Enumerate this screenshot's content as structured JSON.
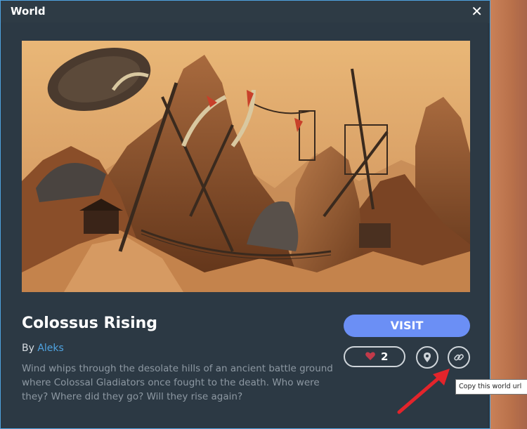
{
  "window": {
    "title": "World",
    "close_glyph": "✕"
  },
  "world": {
    "name": "Colossus Rising",
    "by_prefix": "By ",
    "author": "Aleks",
    "description": "Wind whips through the desolate hills of an ancient battle ground where Colossal Gladiators once fought to the death. Who were they? Where did they go? Will they rise again?"
  },
  "actions": {
    "visit_label": "VISIT",
    "like_count": "2",
    "heart_glyph": "❤"
  },
  "tooltip": {
    "text": "Copy this world url"
  },
  "icons": {
    "location": "map-pin-icon",
    "link": "link-icon",
    "heart": "heart-icon",
    "close": "close-icon"
  },
  "colors": {
    "accent": "#6b8ff5",
    "author_link": "#4fa3e0",
    "heart": "#c23a4a",
    "window_bg": "#2c3944",
    "annotation_arrow": "#e3242b"
  }
}
